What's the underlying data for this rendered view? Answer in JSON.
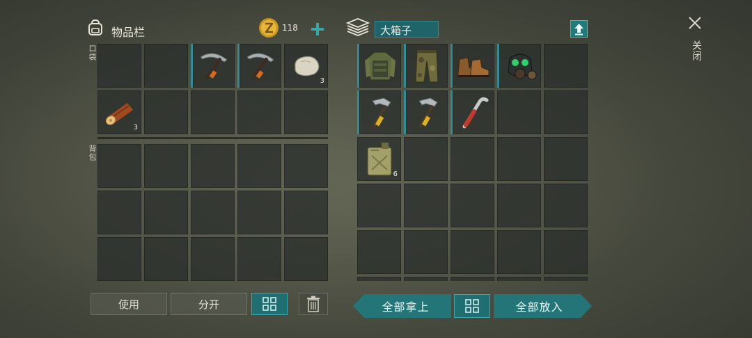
{
  "inventory": {
    "title": "物品栏",
    "icon": "backpack-icon",
    "currency": {
      "amount": "118",
      "icon": "gold-coin-icon",
      "add_icon": "plus-icon"
    },
    "pockets_label": "口袋",
    "backpack_label": "背包",
    "pockets": [
      {
        "item": null
      },
      {
        "item": null
      },
      {
        "item": "pickaxe-icon",
        "marked": true
      },
      {
        "item": "pickaxe-icon",
        "marked": true
      },
      {
        "item": "stone-icon",
        "qty": "3"
      },
      {
        "item": "log-icon",
        "qty": "3"
      },
      {
        "item": null
      },
      {
        "item": null
      },
      {
        "item": null
      },
      {
        "item": null
      }
    ]
  },
  "box": {
    "title": "大箱子",
    "icon": "box-stack-icon",
    "upload_icon": "upload-arrow-icon",
    "items": [
      {
        "item": "armor-vest-icon",
        "marked": true
      },
      {
        "item": "camo-pants-icon",
        "marked": true
      },
      {
        "item": "boots-icon",
        "marked": true
      },
      {
        "item": "gas-mask-icon",
        "marked": true
      },
      {
        "item": null
      },
      {
        "item": "hammer-icon",
        "marked": true
      },
      {
        "item": "hammer-icon",
        "marked": true
      },
      {
        "item": "crowbar-icon",
        "marked": true
      },
      {
        "item": null
      },
      {
        "item": null
      },
      {
        "item": "jerrycan-icon",
        "qty": "6"
      }
    ]
  },
  "buttons": {
    "use": "使用",
    "split": "分开",
    "sort_icon": "grid-sort-icon",
    "trash_icon": "trash-icon",
    "take_all": "全部拿上",
    "put_all": "全部放入"
  },
  "close": {
    "icon": "close-icon",
    "label": "关闭"
  },
  "colors": {
    "accent": "#237578",
    "marker": "#2f8e95",
    "slot": "#2a2e2c"
  }
}
